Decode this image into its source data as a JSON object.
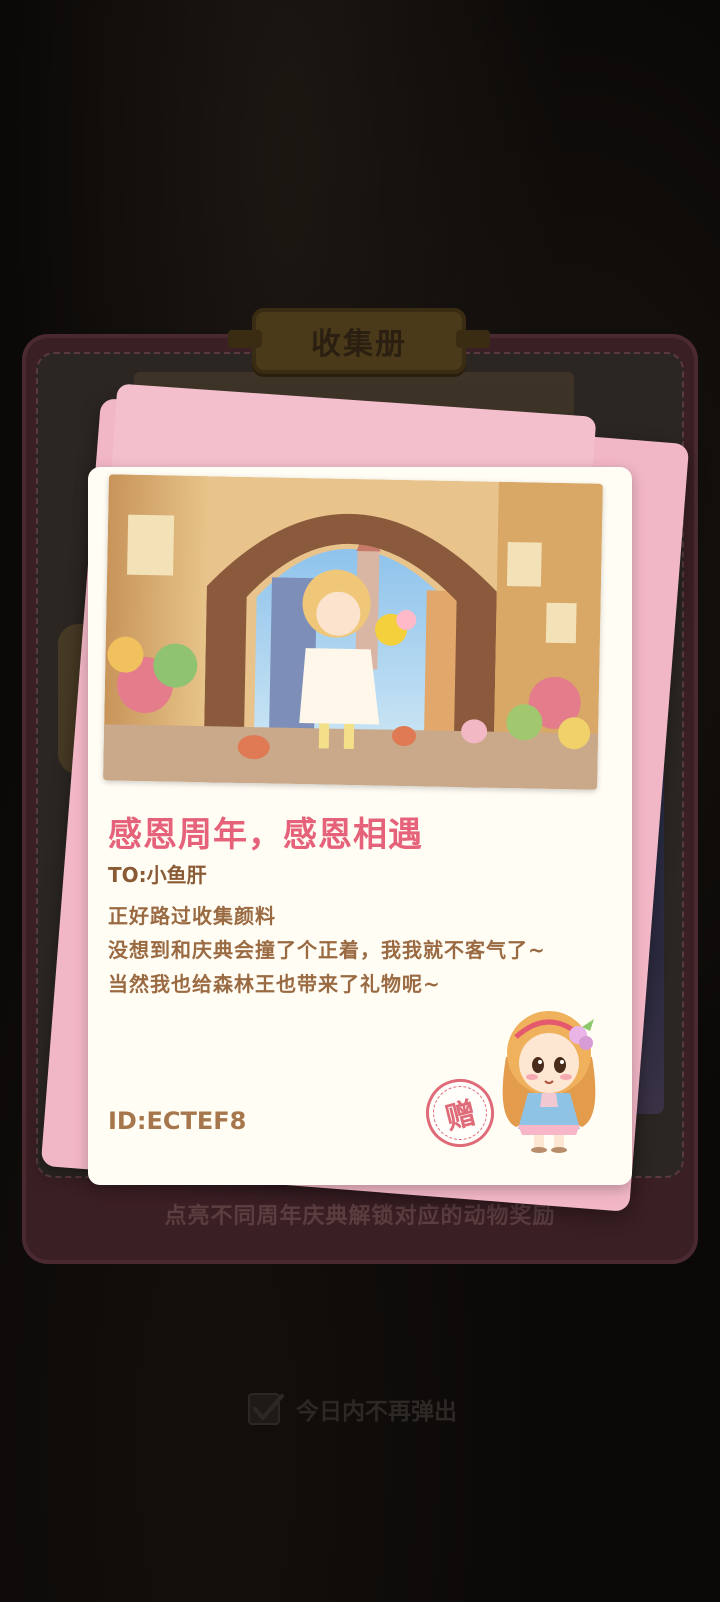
{
  "album": {
    "title": "收集册",
    "hint": "点亮不同周年庆典解锁对应的动物奖励"
  },
  "letter": {
    "title": "感恩周年，感恩相遇",
    "to": "TO:小鱼肝",
    "lines": [
      "正好路过收集颜料",
      "没想到和庆典会撞了个正着，我我就不客气了~",
      "当然我也给森林王也带来了礼物呢~"
    ],
    "id": "ID:ECTEF8",
    "stamp": "赠",
    "illustration_icon": "archway-street-illustration",
    "character_icon": "girl-character-icon"
  },
  "footer": {
    "dont_show_today": "今日内不再弹出",
    "checked": true
  },
  "colors": {
    "title_pink": "#e6627a",
    "envelope_pink": "#f2b7c6",
    "paper": "#fffdf4",
    "body_brown": "#9a6a42"
  }
}
